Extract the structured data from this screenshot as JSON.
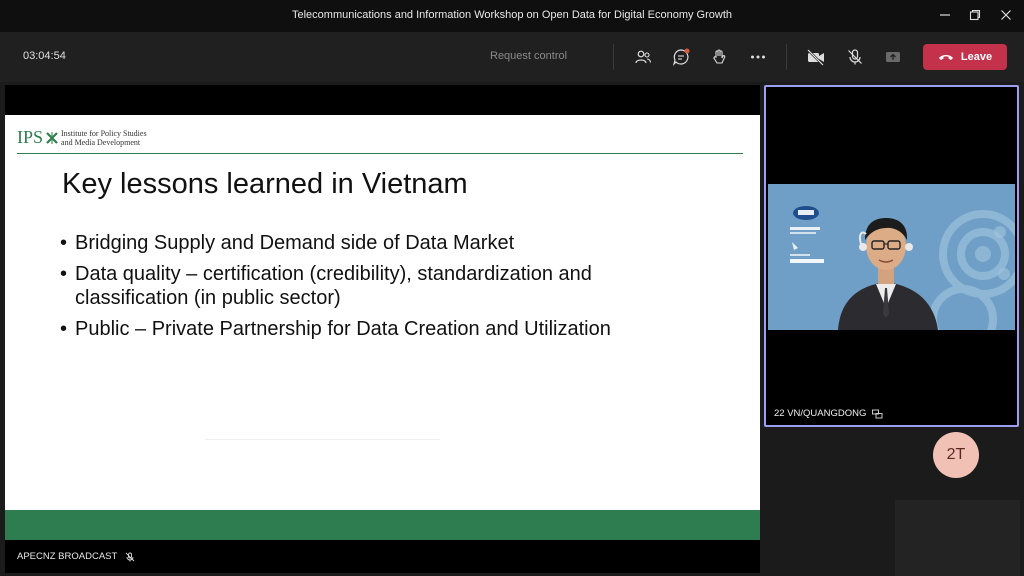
{
  "window": {
    "title": "Telecommunications and Information Workshop on Open Data for Digital Economy Growth"
  },
  "toolbar": {
    "timer": "03:04:54",
    "request_control": "Request control",
    "leave_label": "Leave",
    "leave_color": "#c4314b",
    "icons": [
      "people-icon",
      "chat-icon",
      "raise-hand-icon",
      "more-icon",
      "camera-off-icon",
      "mic-off-icon",
      "share-tray-icon",
      "phone-hangup-icon"
    ]
  },
  "slide": {
    "logo_text": "IPS",
    "logo_subtitle_line1": "Institute for Policy Studies",
    "logo_subtitle_line2": "and Media Development",
    "title": "Key lessons learned in Vietnam",
    "bullets": [
      "Bridging Supply and Demand side of Data Market",
      "Data quality – certification (credibility), standardization and classification (in public sector)",
      "Public – Private Partnership for Data Creation and Utilization"
    ],
    "accent_color": "#2e7d4f"
  },
  "presenter": {
    "name": "APECNZ BROADCAST"
  },
  "participant": {
    "name": "22 VN/QUANGDONG",
    "video_badge_1": "APEC",
    "video_badge_2": "Asia-Pacific Economic Cooperation",
    "video_badge_3": "NEW ZEALAND",
    "video_badge_4": "APEC 2021"
  },
  "avatar": {
    "initials": "2T",
    "color": "#f2c1b6"
  }
}
